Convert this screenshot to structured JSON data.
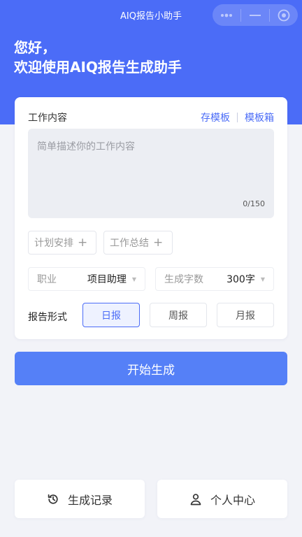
{
  "app": {
    "title": "AIQ报告小助手"
  },
  "capsule": {
    "menu_icon": "more-dots-icon",
    "minimize_icon": "minus-icon",
    "close_icon": "target-close-icon"
  },
  "header": {
    "greeting_line1": "您好，",
    "greeting_line2": "欢迎使用AIQ报告生成助手"
  },
  "form": {
    "work_content_label": "工作内容",
    "save_template": "存模板",
    "template_box": "模板箱",
    "textarea_placeholder": "简单描述你的工作内容",
    "char_counter": "0/150",
    "chips": [
      {
        "label": "计划安排"
      },
      {
        "label": "工作总结"
      }
    ],
    "occupation_label": "职业",
    "occupation_value": "项目助理",
    "word_count_label": "生成字数",
    "word_count_value": "300字",
    "format_label": "报告形式",
    "formats": [
      "日报",
      "周报",
      "月报"
    ],
    "selected_format": "日报"
  },
  "actions": {
    "start": "开始生成"
  },
  "bottom_nav": {
    "history": {
      "label": "生成记录",
      "icon": "history-icon"
    },
    "profile": {
      "label": "个人中心",
      "icon": "user-icon"
    }
  },
  "colors": {
    "primary": "#4b6cf7",
    "button": "#5580f7",
    "background": "#f2f3f8"
  }
}
